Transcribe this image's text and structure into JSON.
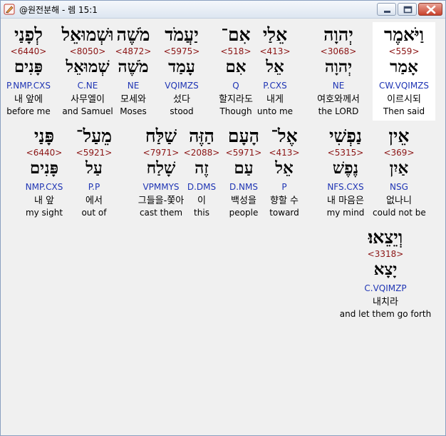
{
  "window": {
    "title": "@원전분해 - 렘 15:1",
    "icons": {
      "app": "pencil-app-icon",
      "minimize": "minimize-icon",
      "maximize": "maximize-icon",
      "close": "close-icon"
    }
  },
  "colors": {
    "code": "#8b1414",
    "parse": "#1f35b4",
    "selected_bg": "#ffffff"
  },
  "rows": [
    [
      {
        "heb": "וַיֹּאמֶר",
        "code": "<559>",
        "lemma": "אָמַר",
        "parse": "CW.VQIMZS",
        "kor": "이르시되",
        "eng": "Then said",
        "selected": true
      },
      {
        "heb": "יְהוָה",
        "code": "<3068>",
        "lemma": "יְהוָה",
        "parse": "NE",
        "kor": "여호와께서",
        "eng": "the LORD"
      },
      {
        "heb": "אֵלַי",
        "code": "<413>",
        "lemma": "אֵל",
        "parse": "P.CXS",
        "kor": "내게",
        "eng": "unto me"
      },
      {
        "heb": "אִם־",
        "code": "<518>",
        "lemma": "אִם",
        "parse": "Q",
        "kor": "할지라도",
        "eng": "Though"
      },
      {
        "heb": "יַעֲמֹד",
        "code": "<5975>",
        "lemma": "עָמַד",
        "parse": "VQIMZS",
        "kor": "섰다",
        "eng": "stood"
      },
      {
        "heb": "מֹשֶׁה",
        "code": "<4872>",
        "lemma": "מֹשֶׁה",
        "parse": "NE",
        "kor": "모세와",
        "eng": "Moses"
      },
      {
        "heb": "וּשְׁמוּאֵל",
        "code": "<8050>",
        "lemma": "שְׁמוּאֵל",
        "parse": "C.NE",
        "kor": "사무엘이",
        "eng": "and Samuel"
      },
      {
        "heb": "לְפָנַי",
        "code": "<6440>",
        "lemma": "פָּנִים",
        "parse": "P.NMP.CXS",
        "kor": "내 앞에",
        "eng": "before me"
      }
    ],
    [
      {
        "heb": "אֵין",
        "code": "<369>",
        "lemma": "אַיִן",
        "parse": "NSG",
        "kor": "없나니",
        "eng": "could not be"
      },
      {
        "heb": "נַפְשִׁי",
        "code": "<5315>",
        "lemma": "נֶפֶשׁ",
        "parse": "NFS.CXS",
        "kor": "내 마음은",
        "eng": "my mind"
      },
      {
        "heb": "אֶל־",
        "code": "<413>",
        "lemma": "אֵל",
        "parse": "P",
        "kor": "향할 수",
        "eng": "toward"
      },
      {
        "heb": "הָעָם",
        "code": "<5971>",
        "lemma": "עַם",
        "parse": "D.NMS",
        "kor": "백성을",
        "eng": "people"
      },
      {
        "heb": "הַזֶּה",
        "code": "<2088>",
        "lemma": "זֶה",
        "parse": "D.DMS",
        "kor": "이",
        "eng": "this"
      },
      {
        "heb": "שַׁלַּח",
        "code": "<7971>",
        "lemma": "שָׁלַח",
        "parse": "VPMMYS",
        "kor": "그들을-쫓아",
        "eng": "cast them"
      },
      {
        "heb": "מֵעַל־",
        "code": "<5921>",
        "lemma": "עַל",
        "parse": "P.P",
        "kor": "에서",
        "eng": "out of"
      },
      {
        "heb": "פָּנַי",
        "code": "<6440>",
        "lemma": "פָּנִים",
        "parse": "NMP.CXS",
        "kor": "내 앞",
        "eng": "my sight"
      }
    ],
    [
      {
        "heb": "וְיֵצֵאוּ׃",
        "code": "<3318>",
        "lemma": "יָצָא",
        "parse": "C.VQIMZP",
        "kor": "내치라",
        "eng": "and let them go forth"
      }
    ]
  ]
}
